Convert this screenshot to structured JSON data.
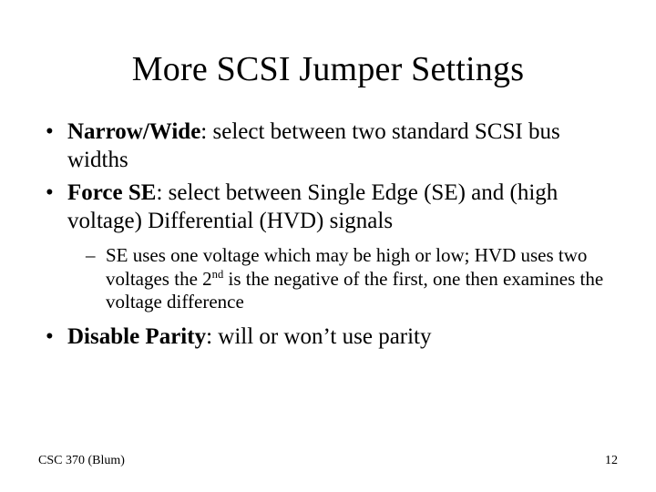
{
  "slide": {
    "title": "More SCSI Jumper Settings",
    "bullets": [
      {
        "term": "Narrow/Wide",
        "desc": ": select between two standard SCSI bus widths"
      },
      {
        "term": "Force SE",
        "desc": ": select between Single Edge (SE) and (high voltage) Differential (HVD) signals",
        "sub": {
          "pre": "SE uses one voltage which may be high or low; HVD uses two voltages the 2",
          "ord": "nd",
          "post": " is the negative of the first, one then examines the voltage difference"
        }
      },
      {
        "term": "Disable Parity",
        "desc": ":  will or won’t use parity"
      }
    ],
    "footer_left": "CSC 370 (Blum)",
    "footer_right": "12"
  }
}
